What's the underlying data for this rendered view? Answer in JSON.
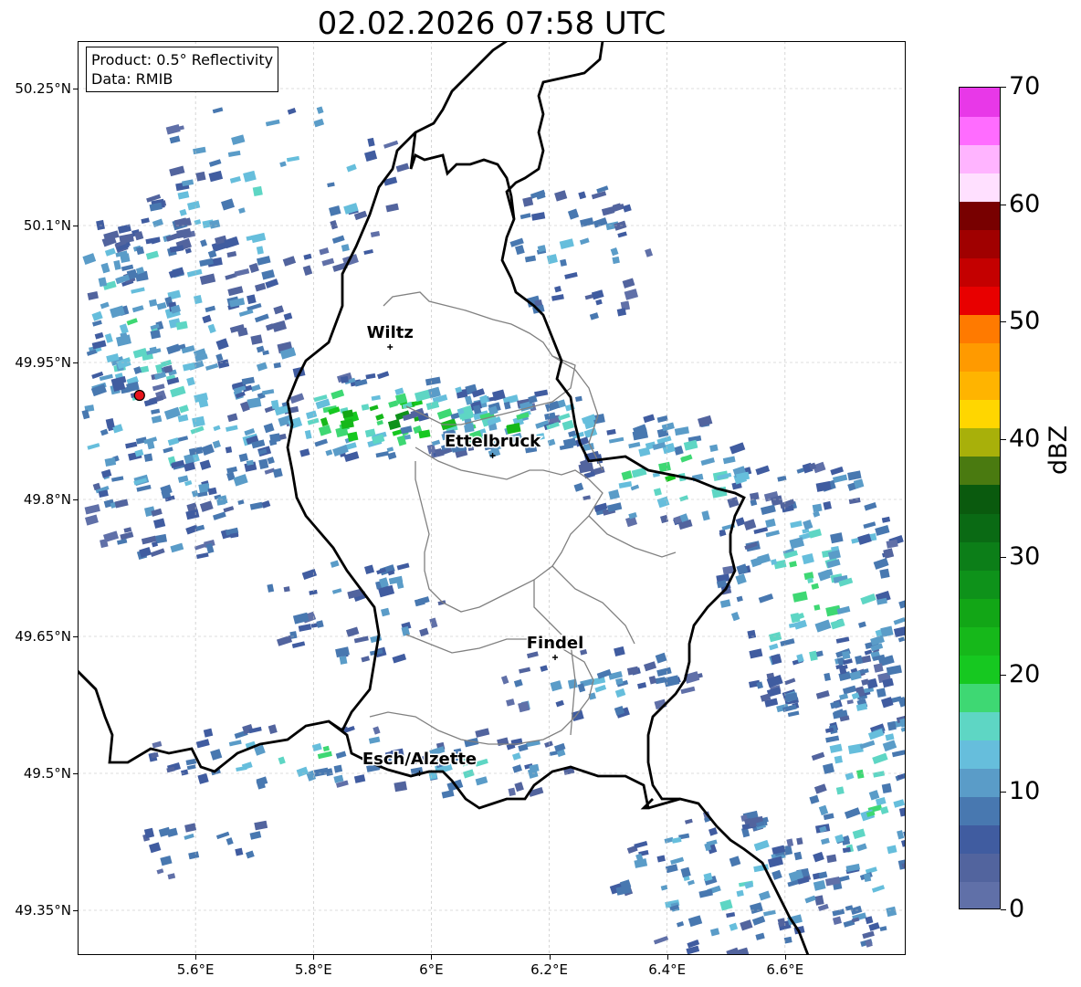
{
  "title": "02.02.2026 07:58 UTC",
  "info": {
    "product": "Product: 0.5° Reflectivity",
    "data_source": "Data: RMIB"
  },
  "map": {
    "lon_range": [
      5.4,
      6.8
    ],
    "lat_range": [
      49.3,
      50.3
    ],
    "lat_ticks": [
      {
        "value": 50.25,
        "label": "50.25°N"
      },
      {
        "value": 50.1,
        "label": "50.1°N"
      },
      {
        "value": 49.95,
        "label": "49.95°N"
      },
      {
        "value": 49.8,
        "label": "49.8°N"
      },
      {
        "value": 49.65,
        "label": "49.65°N"
      },
      {
        "value": 49.5,
        "label": "49.5°N"
      },
      {
        "value": 49.35,
        "label": "49.35°N"
      }
    ],
    "lon_ticks": [
      {
        "value": 5.6,
        "label": "5.6°E"
      },
      {
        "value": 5.8,
        "label": "5.8°E"
      },
      {
        "value": 6.0,
        "label": "6°E"
      },
      {
        "value": 6.2,
        "label": "6.2°E"
      },
      {
        "value": 6.4,
        "label": "6.4°E"
      },
      {
        "value": 6.6,
        "label": "6.6°E"
      }
    ],
    "cities": [
      {
        "name": "Wiltz",
        "lon": 5.93,
        "lat": 49.967
      },
      {
        "name": "Ettelbruck",
        "lon": 6.104,
        "lat": 49.848
      },
      {
        "name": "Findel",
        "lon": 6.21,
        "lat": 49.627
      },
      {
        "name": "Esch/Alzette",
        "lon": 5.98,
        "lat": 49.5
      }
    ],
    "radar_site": {
      "lon": 5.505,
      "lat": 49.914,
      "color": "#e8141c"
    },
    "grid": true
  },
  "colorbar": {
    "unit": "dBZ",
    "min": 0,
    "max": 70,
    "step": 5,
    "labels": [
      "70",
      "60",
      "50",
      "40",
      "30",
      "20",
      "10",
      "0"
    ],
    "colors": [
      "#6070a8",
      "#52649e",
      "#405ca0",
      "#4878b0",
      "#5a9cc8",
      "#66bedc",
      "#5ed6c4",
      "#3ed873",
      "#16c820",
      "#16b81a",
      "#12a616",
      "#0e921a",
      "#0c7e18",
      "#0a6a14",
      "#0a5a0e",
      "#4a7a10",
      "#a8b00a",
      "#ffd600",
      "#ffb400",
      "#ff9a00",
      "#ff7a00",
      "#e80000",
      "#c40000",
      "#a00000",
      "#780000",
      "#ffe0ff",
      "#ffb4ff",
      "#ff6cff",
      "#e838e8"
    ]
  },
  "colors": {
    "border_country": "#000000",
    "border_canton": "#808080",
    "grid": "#bbbbbb"
  }
}
